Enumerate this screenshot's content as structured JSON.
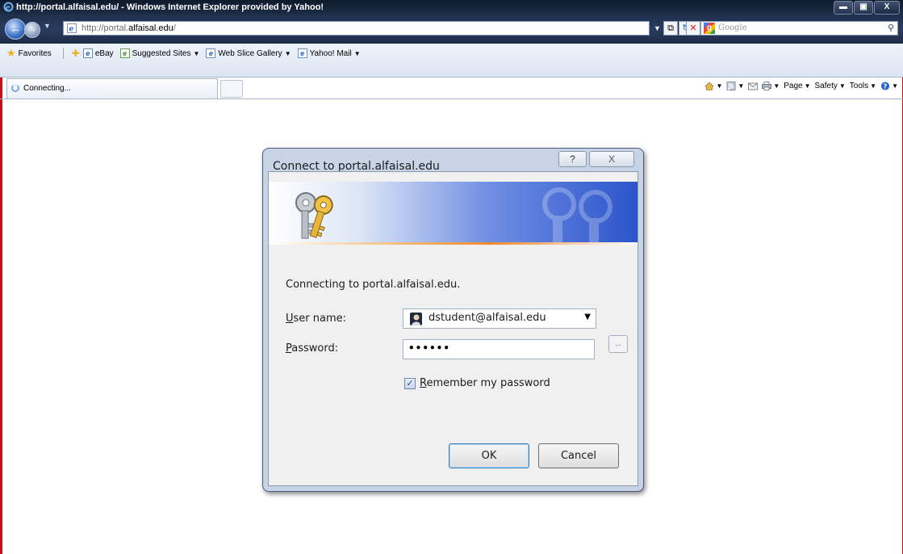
{
  "window": {
    "title": "http://portal.alfaisal.edu/ - Windows Internet Explorer provided by Yahoo!"
  },
  "address_bar": {
    "url_prefix": "http://portal.",
    "url_domain": "alfaisal.edu",
    "url_suffix": "/"
  },
  "search": {
    "placeholder": "Google"
  },
  "favorites_bar": {
    "favorites_label": "Favorites",
    "items": [
      {
        "label": "eBay",
        "has_dropdown": false
      },
      {
        "label": "Suggested Sites",
        "has_dropdown": true
      },
      {
        "label": "Web Slice Gallery",
        "has_dropdown": true
      },
      {
        "label": "Yahoo! Mail",
        "has_dropdown": true
      }
    ]
  },
  "tab": {
    "label": "Connecting..."
  },
  "command_bar": {
    "page": "Page",
    "safety": "Safety",
    "tools": "Tools"
  },
  "dialog": {
    "title": "Connect to portal.alfaisal.edu",
    "help_glyph": "?",
    "close_glyph": "X",
    "message": "Connecting to portal.alfaisal.edu.",
    "user_label_accel": "U",
    "user_label_rest": "ser name:",
    "user_value": "dstudent@alfaisal.edu",
    "password_label_accel": "P",
    "password_label_rest": "assword:",
    "password_mask": "••••••",
    "remember_accel": "R",
    "remember_rest": "emember my password",
    "remember_checked": true,
    "ok": "OK",
    "cancel": "Cancel",
    "browse": "..."
  },
  "colors": {
    "frame_border": "#c8101a",
    "banner_blue": "#2c55cc"
  }
}
